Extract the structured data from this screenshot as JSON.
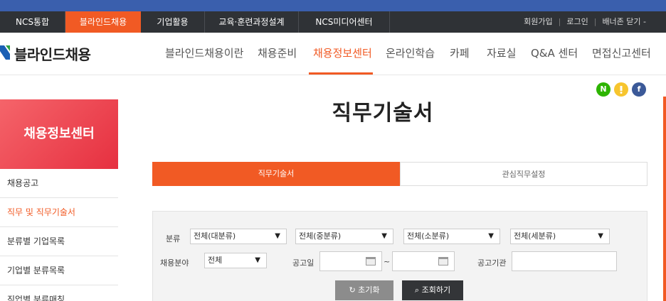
{
  "top_nav": {
    "items": [
      {
        "label": "NCS통합"
      },
      {
        "label": "블라인드채용"
      },
      {
        "label": "기업활용"
      },
      {
        "label": "교육·훈련과정설계"
      },
      {
        "label": "NCS미디어센터"
      }
    ],
    "right": {
      "signup": "회원가입",
      "login": "로그인",
      "banner_close": "배너존 닫기 -"
    }
  },
  "header": {
    "logo": "블라인드채용",
    "gnb": [
      "블라인드채용이란",
      "채용준비",
      "채용정보센터",
      "온라인학습",
      "카페",
      "자료실",
      "Q&A 센터",
      "면접신고센터"
    ]
  },
  "share": {
    "naver": "N",
    "kakao": "",
    "facebook": "f"
  },
  "sidebar": {
    "title": "채용정보센터",
    "items": [
      "채용공고",
      "직무 및 직무기술서",
      "분류별 기업목록",
      "기업별 분류목록",
      "직업별 분류매칭"
    ]
  },
  "main": {
    "title": "직무기술서",
    "tabs": [
      "직무기술서",
      "관심직무설정"
    ]
  },
  "search": {
    "category_label": "분류",
    "selects": [
      "전체(대분류)",
      "전체(중분류)",
      "전체(소분류)",
      "전체(세분류)"
    ],
    "field_label": "채용분야",
    "field_value": "전체",
    "date_label": "공고일",
    "date_sep": "~",
    "org_label": "공고기관",
    "reset_label": "초기화",
    "search_label": "조회하기"
  },
  "colors": {
    "accent": "#f15a24",
    "top_bg": "#2f3236",
    "stripe": "#3a5fad"
  }
}
